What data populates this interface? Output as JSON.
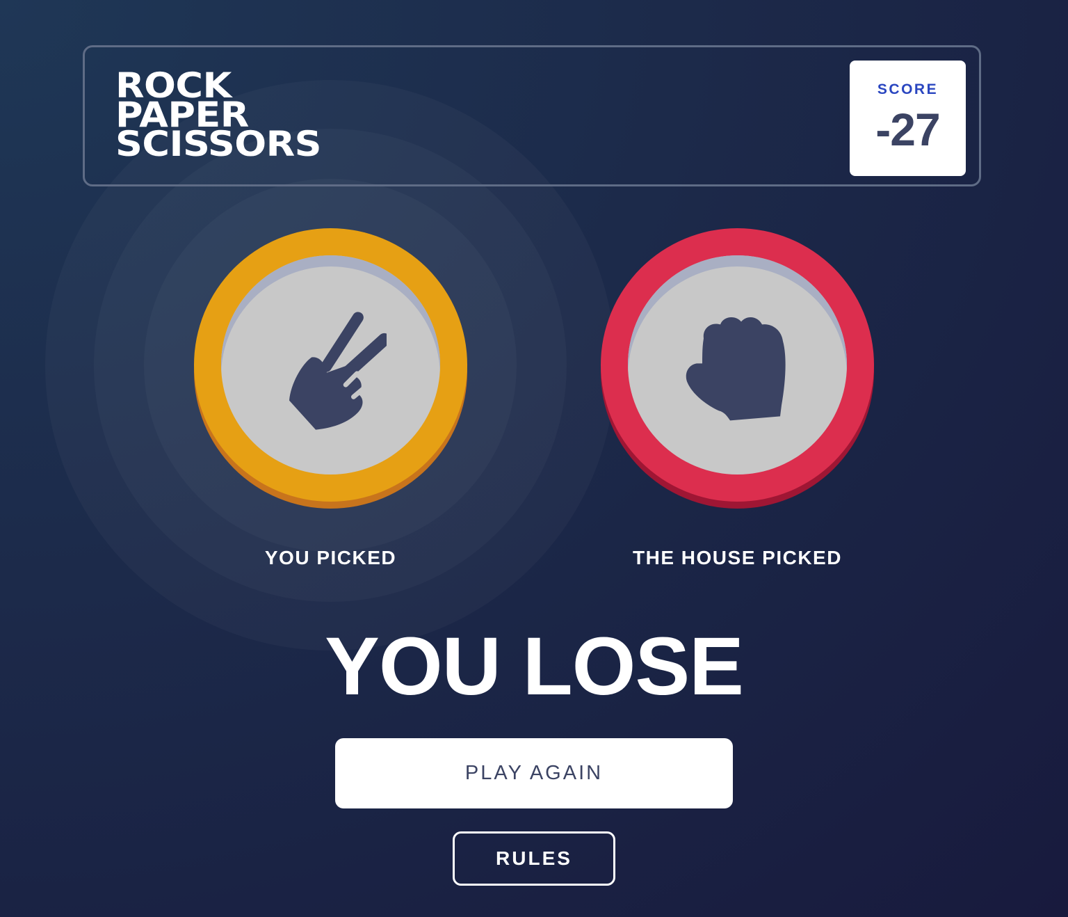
{
  "header": {
    "title_lines": [
      "ROCK",
      "PAPER",
      "SCISSORS"
    ],
    "score_label": "SCORE",
    "score_value": "-27"
  },
  "picks": {
    "player": {
      "label": "YOU PICKED",
      "choice_icon": "scissors-icon",
      "ring_color": "#e6a014"
    },
    "house": {
      "label": "THE HOUSE PICKED",
      "choice_icon": "rock-icon",
      "ring_color": "#dc2e4e"
    }
  },
  "result": {
    "text": "YOU LOSE"
  },
  "actions": {
    "play_again_label": "PLAY AGAIN",
    "rules_label": "RULES"
  },
  "colors": {
    "score_label": "#2a46c0",
    "dark_text": "#3b4363",
    "background": "#1c2a4a"
  }
}
